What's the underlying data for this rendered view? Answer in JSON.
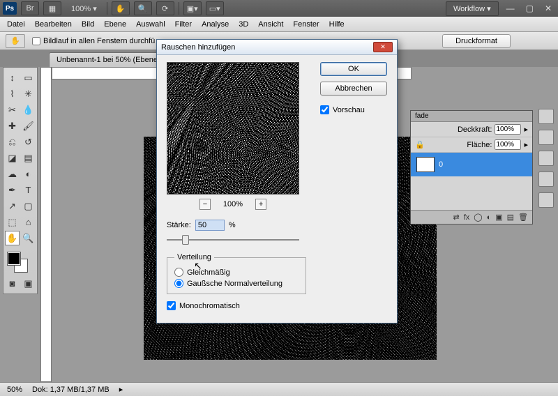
{
  "top": {
    "ps": "Ps",
    "br": "Br",
    "zoom": "100% ▾",
    "workspace": "Workflow ▾"
  },
  "menu": {
    "datei": "Datei",
    "bearbeiten": "Bearbeiten",
    "bild": "Bild",
    "ebene": "Ebene",
    "auswahl": "Auswahl",
    "filter": "Filter",
    "analyse": "Analyse",
    "dreid": "3D",
    "ansicht": "Ansicht",
    "fenster": "Fenster",
    "hilfe": "Hilfe"
  },
  "options": {
    "scroll_all": "Bildlauf in allen Fenstern durchfü",
    "print_format": "Druckformat"
  },
  "doc": {
    "tab": "Unbenannt-1 bei 50% (Ebene"
  },
  "layers": {
    "tab": "fade",
    "opacity_label": "Deckkraft:",
    "opacity_value": "100%",
    "fill_label": "Fläche:",
    "fill_value": "100%",
    "active_layer": "0"
  },
  "status": {
    "zoom": "50%",
    "docsize": "Dok: 1,37 MB/1,37 MB"
  },
  "dialog": {
    "title": "Rauschen hinzufügen",
    "ok": "OK",
    "cancel": "Abbrechen",
    "preview": "Vorschau",
    "zoom_pct": "100%",
    "amount_label": "Stärke:",
    "amount_value": "50",
    "amount_unit": "%",
    "distribution_legend": "Verteilung",
    "uniform": "Gleichmäßig",
    "gaussian": "Gaußsche Normalverteilung",
    "mono": "Monochromatisch"
  },
  "chart_data": {
    "type": "noise-preview",
    "amount_percent": 50,
    "distribution": "gaussian",
    "monochromatic": true,
    "preview_zoom_percent": 100
  }
}
